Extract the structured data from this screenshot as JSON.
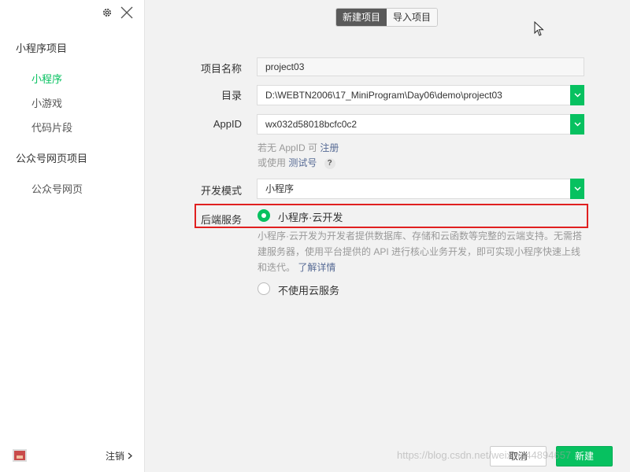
{
  "sidebar": {
    "groups": [
      {
        "label": "小程序项目",
        "items": [
          "小程序",
          "小游戏",
          "代码片段"
        ]
      },
      {
        "label": "公众号网页项目",
        "items": [
          "公众号网页"
        ]
      }
    ],
    "logout_label": "注销"
  },
  "tabs": {
    "new": "新建项目",
    "import": "导入项目"
  },
  "form": {
    "name_label": "项目名称",
    "name_value": "project03",
    "dir_label": "目录",
    "dir_value": "D:\\WEBTN2006\\17_MiniProgram\\Day06\\demo\\project03",
    "appid_label": "AppID",
    "appid_value": "wx032d58018bcfc0c2",
    "appid_hint_prefix": "若无 AppID 可",
    "appid_hint_link": "注册",
    "appid_alt_prefix": "或使用",
    "appid_alt_link": "测试号",
    "help_mark": "?",
    "mode_label": "开发模式",
    "mode_value": "小程序",
    "backend_label": "后端服务",
    "cloud_option": "小程序·云开发",
    "cloud_desc": "小程序·云开发为开发者提供数据库、存储和云函数等完整的云端支持。无需搭建服务器，使用平台提供的 API 进行核心业务开发，即可实现小程序快速上线和迭代。",
    "cloud_link": "了解详情",
    "no_cloud_option": "不使用云服务"
  },
  "footer": {
    "cancel": "取消",
    "create": "新建"
  },
  "watermark": "https://blog.csdn.net/weixin_44894657",
  "colors": {
    "accent": "#07c160",
    "highlight": "#e02020",
    "link": "#576b95"
  }
}
